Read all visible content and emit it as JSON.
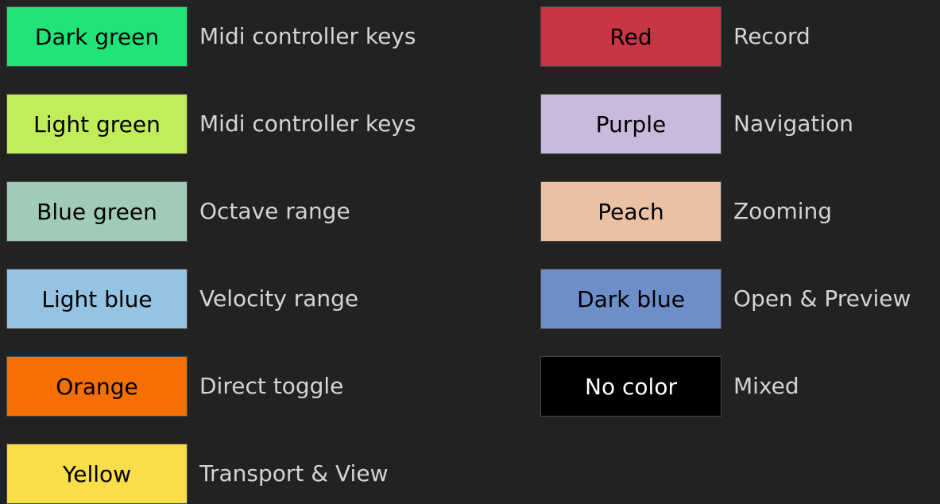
{
  "legend": {
    "left": [
      {
        "color_name": "Dark green",
        "description": "Midi controller keys",
        "swatch_color": "#1fe579",
        "text_color": "#000000"
      },
      {
        "color_name": "Light green",
        "description": "Midi controller keys",
        "swatch_color": "#c1ed5b",
        "text_color": "#000000"
      },
      {
        "color_name": "Blue green",
        "description": "Octave range",
        "swatch_color": "#a0cbb9",
        "text_color": "#000000"
      },
      {
        "color_name": "Light blue",
        "description": "Velocity range",
        "swatch_color": "#95c3e4",
        "text_color": "#000000"
      },
      {
        "color_name": "Orange",
        "description": "Direct toggle",
        "swatch_color": "#f56f03",
        "text_color": "#000000"
      },
      {
        "color_name": "Yellow",
        "description": "Transport & View",
        "swatch_color": "#f9dd4b",
        "text_color": "#000000"
      }
    ],
    "right": [
      {
        "color_name": "Red",
        "description": "Record",
        "swatch_color": "#c93545",
        "text_color": "#000000"
      },
      {
        "color_name": "Purple",
        "description": "Navigation",
        "swatch_color": "#c9b9dc",
        "text_color": "#000000"
      },
      {
        "color_name": "Peach",
        "description": "Zooming",
        "swatch_color": "#ebc1a3",
        "text_color": "#000000"
      },
      {
        "color_name": "Dark blue",
        "description": "Open & Preview",
        "swatch_color": "#6d8ec9",
        "text_color": "#000000"
      },
      {
        "color_name": "No color",
        "description": "Mixed",
        "swatch_color": "#000000",
        "text_color": "#ffffff"
      }
    ]
  }
}
